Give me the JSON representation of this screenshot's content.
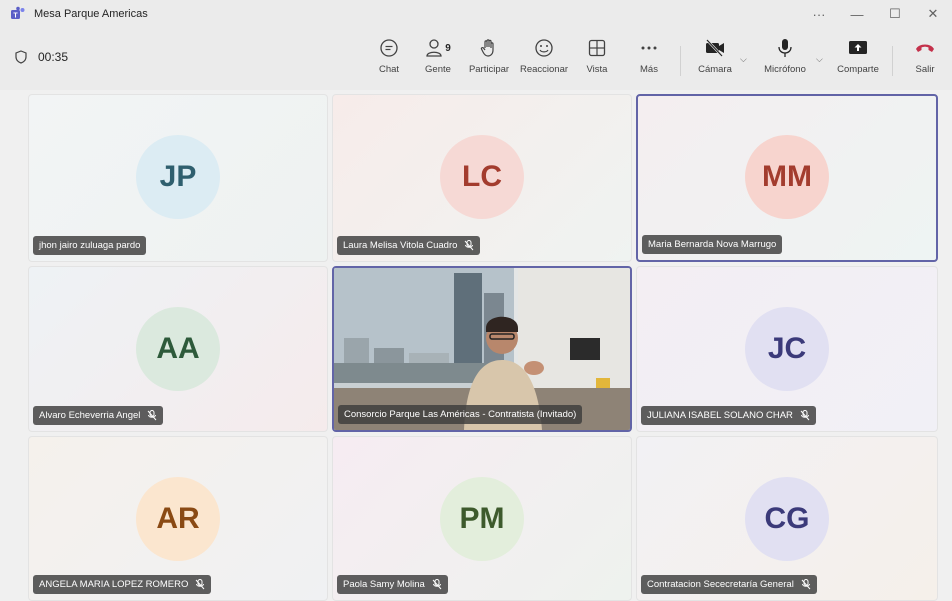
{
  "window": {
    "title": "Mesa Parque Americas",
    "controls": [
      "···",
      "—",
      "☐",
      "✕"
    ]
  },
  "toolbar": {
    "timer": "00:35",
    "chat_label": "Chat",
    "people_label": "Gente",
    "people_count": "9",
    "raise_label": "Participar",
    "react_label": "Reaccionar",
    "view_label": "Vista",
    "more_label": "Más",
    "camera_label": "Cámara",
    "mic_label": "Micrófono",
    "share_label": "Comparte",
    "leave_label": "Salir"
  },
  "tiles": [
    {
      "initials": "JP",
      "name": "jhon jairo zuluaga pardo",
      "muted": false,
      "active": false,
      "avatar_bg": "#dcecf3",
      "avatar_fg": "#2f5f6e"
    },
    {
      "initials": "LC",
      "name": "Laura Melisa Vitola Cuadro",
      "muted": true,
      "active": false,
      "avatar_bg": "#f6d9d5",
      "avatar_fg": "#a33c2e"
    },
    {
      "initials": "MM",
      "name": "Maria Bernarda Nova Marrugo",
      "muted": false,
      "active": true,
      "avatar_bg": "#f7d4ce",
      "avatar_fg": "#a33c2e"
    },
    {
      "initials": "AA",
      "name": "Alvaro Echeverria Angel",
      "muted": true,
      "active": false,
      "avatar_bg": "#dbe9de",
      "avatar_fg": "#2d5a3a"
    },
    {
      "initials": "",
      "name": "Consorcio Parque Las Américas - Contratista (Invitado)",
      "muted": false,
      "active": true,
      "video": true
    },
    {
      "initials": "JC",
      "name": "JULIANA ISABEL SOLANO CHAR",
      "muted": true,
      "active": false,
      "avatar_bg": "#e1e0f2",
      "avatar_fg": "#3b3a7a"
    },
    {
      "initials": "AR",
      "name": "ANGELA MARIA LOPEZ ROMERO",
      "muted": true,
      "active": false,
      "avatar_bg": "#fbe6cf",
      "avatar_fg": "#8a4a14"
    },
    {
      "initials": "PM",
      "name": "Paola Samy Molina",
      "muted": true,
      "active": false,
      "avatar_bg": "#e3eedc",
      "avatar_fg": "#3d5a2c"
    },
    {
      "initials": "CG",
      "name": "Contratacion Sececretaría General",
      "muted": true,
      "active": false,
      "avatar_bg": "#e1e0f2",
      "avatar_fg": "#3b3a7a"
    }
  ],
  "colors": {
    "accent": "#6264a7",
    "leave": "#c4314b"
  }
}
